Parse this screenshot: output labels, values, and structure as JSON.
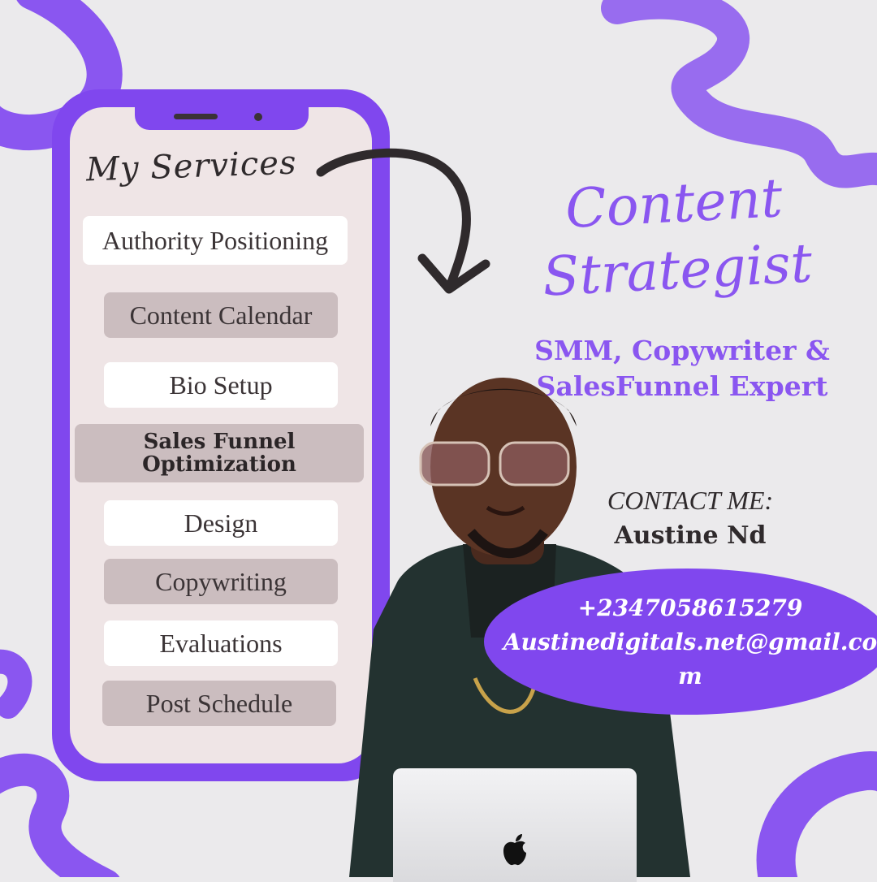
{
  "phone": {
    "heading": "My Services",
    "services": [
      {
        "label": "Authority Positioning"
      },
      {
        "label": "Content Calendar"
      },
      {
        "label": "Bio Setup"
      },
      {
        "label_line1": "Sales Funnel",
        "label_line2": "Optimization"
      },
      {
        "label": "Design"
      },
      {
        "label": "Copywriting"
      },
      {
        "label": "Evaluations"
      },
      {
        "label": "Post Schedule"
      }
    ]
  },
  "headline": {
    "line1": "Content",
    "line2": "Strategist"
  },
  "subtitle": {
    "line1": "SMM, Copywriter &",
    "line2": "SalesFunnel Expert"
  },
  "contact": {
    "label": "CONTACT ME:",
    "name": "Austine Nd",
    "phone": "+2347058615279",
    "email": "Austinedigitals.net@gmail.com"
  },
  "colors": {
    "accent": "#8047ee",
    "background": "#ebeaec",
    "screen": "#efe5e6",
    "pill_gray": "#cbbdbf"
  },
  "icons": [
    "curved-arrow-icon",
    "apple-logo-icon"
  ]
}
